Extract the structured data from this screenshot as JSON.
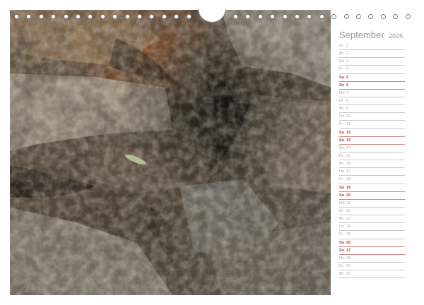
{
  "calendar": {
    "month": "September",
    "year": "2026",
    "weekend_color": "#b33b3b",
    "days": [
      {
        "dow": "Di",
        "num": "1",
        "weekend": false
      },
      {
        "dow": "Mi",
        "num": "2",
        "weekend": false
      },
      {
        "dow": "Do",
        "num": "3",
        "weekend": false
      },
      {
        "dow": "Fr",
        "num": "4",
        "weekend": false
      },
      {
        "dow": "Sa",
        "num": "5",
        "weekend": true
      },
      {
        "dow": "So",
        "num": "6",
        "weekend": true
      },
      {
        "dow": "Mo",
        "num": "7",
        "weekend": false
      },
      {
        "dow": "Di",
        "num": "8",
        "weekend": false
      },
      {
        "dow": "Mi",
        "num": "9",
        "weekend": false
      },
      {
        "dow": "Do",
        "num": "10",
        "weekend": false
      },
      {
        "dow": "Fr",
        "num": "11",
        "weekend": false
      },
      {
        "dow": "Sa",
        "num": "12",
        "weekend": true
      },
      {
        "dow": "So",
        "num": "13",
        "weekend": true
      },
      {
        "dow": "Mo",
        "num": "14",
        "weekend": false
      },
      {
        "dow": "Di",
        "num": "15",
        "weekend": false
      },
      {
        "dow": "Mi",
        "num": "16",
        "weekend": false
      },
      {
        "dow": "Do",
        "num": "17",
        "weekend": false
      },
      {
        "dow": "Fr",
        "num": "18",
        "weekend": false
      },
      {
        "dow": "Sa",
        "num": "19",
        "weekend": true
      },
      {
        "dow": "So",
        "num": "20",
        "weekend": true
      },
      {
        "dow": "Mo",
        "num": "21",
        "weekend": false
      },
      {
        "dow": "Di",
        "num": "22",
        "weekend": false
      },
      {
        "dow": "Mi",
        "num": "23",
        "weekend": false
      },
      {
        "dow": "Do",
        "num": "24",
        "weekend": false
      },
      {
        "dow": "Fr",
        "num": "25",
        "weekend": false
      },
      {
        "dow": "Sa",
        "num": "26",
        "weekend": true
      },
      {
        "dow": "So",
        "num": "27",
        "weekend": true
      },
      {
        "dow": "Mo",
        "num": "28",
        "weekend": false
      },
      {
        "dow": "Di",
        "num": "29",
        "weekend": false
      },
      {
        "dow": "Mi",
        "num": "30",
        "weekend": false
      }
    ]
  }
}
